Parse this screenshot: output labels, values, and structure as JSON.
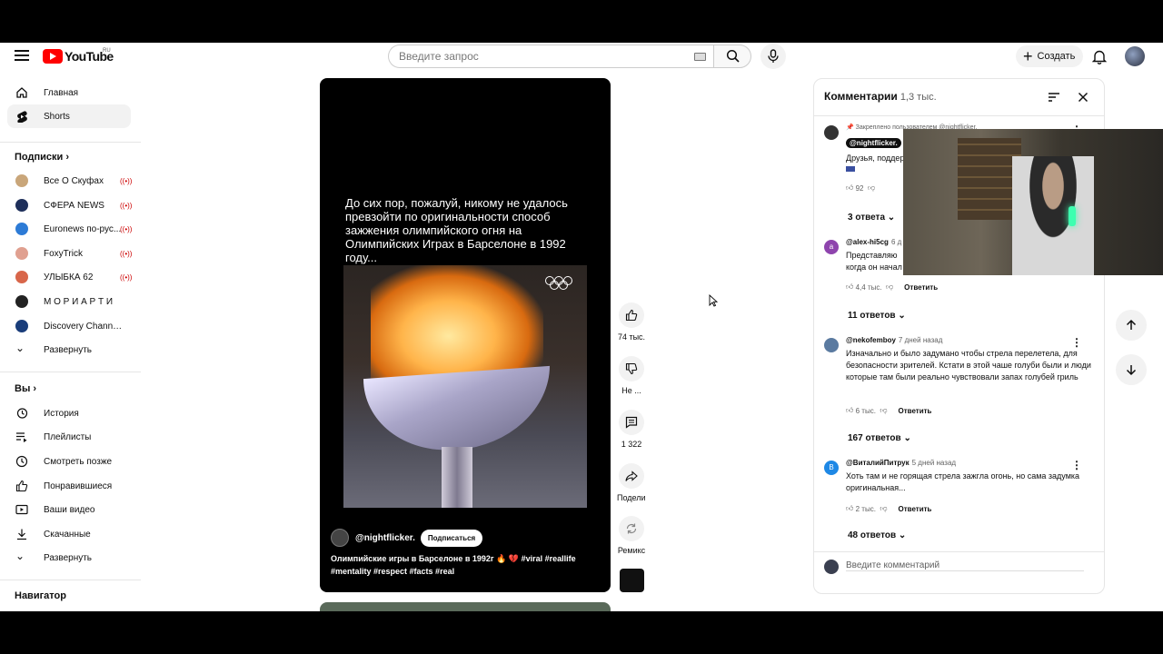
{
  "header": {
    "logo_text": "YouTube",
    "region": "RU",
    "search_placeholder": "Введите запрос",
    "create_label": "Создать"
  },
  "sidebar": {
    "main": [
      {
        "label": "Главная"
      },
      {
        "label": "Shorts"
      }
    ],
    "subs_heading": "Подписки",
    "subs": [
      {
        "label": "Все О Скуфах",
        "color": "#c9a67a"
      },
      {
        "label": "СФЕРА NEWS",
        "color": "#1e2f5a"
      },
      {
        "label": "Euronews по-рус...",
        "color": "#2d7bd6"
      },
      {
        "label": "FoxyTrick",
        "color": "#e0a090"
      },
      {
        "label": "УЛЫБКА 62",
        "color": "#d8664a"
      },
      {
        "label": "М О Р И А Р Т И",
        "color": "#222222"
      },
      {
        "label": "Discovery Channel ...",
        "color": "#1a3d7a"
      }
    ],
    "subs_expand": "Развернуть",
    "you_heading": "Вы",
    "you": [
      {
        "label": "История"
      },
      {
        "label": "Плейлисты"
      },
      {
        "label": "Смотреть позже"
      },
      {
        "label": "Понравившиеся"
      },
      {
        "label": "Ваши видео"
      },
      {
        "label": "Скачанные"
      }
    ],
    "you_expand": "Развернуть",
    "navigator_heading": "Навигатор"
  },
  "video": {
    "overlay_text": "До сих пор, пожалуй, никому не удалось превзойти по оригинальности способ зажжения олимпийского огня на Олимпийских Играх в Барселоне в 1992 году...",
    "author": "@nightflicker.",
    "subscribe_label": "Подписаться",
    "description": "Олимпийские игры в Барселоне в 1992г 🔥 💔 #viral #reallife #mentality #respect #facts #real"
  },
  "actions": {
    "likes": "74 тыс.",
    "dislike": "Не ...",
    "comments": "1 322",
    "share": "Подели...",
    "remix": "Ремикс"
  },
  "comments_panel": {
    "title": "Комментарии",
    "count": "1,3 тыс.",
    "pinned_label": "Закреплено пользователем @nightflicker.",
    "pinned_author": "@nightflicker.",
    "pinned_text": "Друзья, поддер",
    "pinned_likes": "92",
    "pinned_replies": "3 ответа",
    "reply_label": "Ответить",
    "items": [
      {
        "author": "@alex-hi5cg",
        "time": "6 д",
        "text": "Представляю когда он начал",
        "likes": "4,4 тыс.",
        "replies": "11 ответов",
        "avatar_letter": "a",
        "avatar_color": "#8e44ad"
      },
      {
        "author": "@nekofemboy",
        "time": "7 дней назад",
        "text": "Изначально и было задумано чтобы стрела перелетела, для безопасности зрителей. Кстати в этой чаше голуби были и люди которые там были реально чувствовали запах голубей гриль",
        "likes": "6 тыс.",
        "replies": "167 ответов",
        "avatar_letter": "",
        "avatar_color": "#5a7aa0"
      },
      {
        "author": "@ВиталийПитрук",
        "time": "5 дней назад",
        "text": "Хоть там и не горящая стрела зажгла огонь, но сама задумка оригинальная...",
        "likes": "2 тыс.",
        "replies": "48 ответов",
        "avatar_letter": "В",
        "avatar_color": "#1e88e5"
      }
    ],
    "input_placeholder": "Введите комментарий"
  }
}
